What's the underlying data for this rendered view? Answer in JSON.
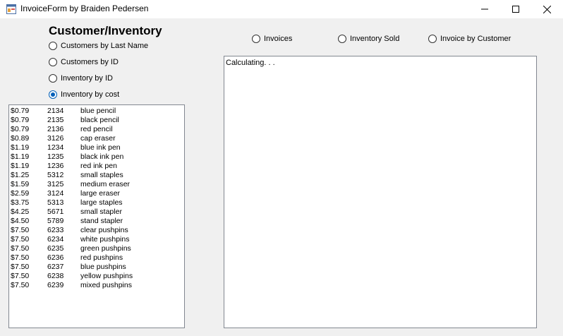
{
  "window": {
    "title": "InvoiceForm by Braiden Pedersen"
  },
  "left_panel": {
    "heading": "Customer/Inventory",
    "options": [
      {
        "label": "Customers by Last Name",
        "checked": false
      },
      {
        "label": "Customers by ID",
        "checked": false
      },
      {
        "label": "Inventory by ID",
        "checked": false
      },
      {
        "label": "Inventory by cost",
        "checked": true
      }
    ]
  },
  "top_options": [
    {
      "label": "Invoices",
      "checked": false
    },
    {
      "label": "Inventory Sold",
      "checked": false
    },
    {
      "label": "Invoice by Customer",
      "checked": false
    }
  ],
  "inventory_list": [
    [
      "$0.79",
      "2134",
      "blue pencil"
    ],
    [
      "$0.79",
      "2135",
      "black pencil"
    ],
    [
      "$0.79",
      "2136",
      "red pencil"
    ],
    [
      "$0.89",
      "3126",
      "cap eraser"
    ],
    [
      "$1.19",
      "1234",
      "blue ink pen"
    ],
    [
      "$1.19",
      "1235",
      "black ink pen"
    ],
    [
      "$1.19",
      "1236",
      "red ink pen"
    ],
    [
      "$1.25",
      "5312",
      "small staples"
    ],
    [
      "$1.59",
      "3125",
      "medium eraser"
    ],
    [
      "$2.59",
      "3124",
      "large eraser"
    ],
    [
      "$3.75",
      "5313",
      "large staples"
    ],
    [
      "$4.25",
      "5671",
      "small stapler"
    ],
    [
      "$4.50",
      "5789",
      "stand stapler"
    ],
    [
      "$7.50",
      "6233",
      "clear pushpins"
    ],
    [
      "$7.50",
      "6234",
      "white pushpins"
    ],
    [
      "$7.50",
      "6235",
      "green pushpins"
    ],
    [
      "$7.50",
      "6236",
      "red pushpins"
    ],
    [
      "$7.50",
      "6237",
      "blue pushpins"
    ],
    [
      "$7.50",
      "6238",
      "yellow pushpins"
    ],
    [
      "$7.50",
      "6239",
      "mixed pushpins"
    ]
  ],
  "output_box": {
    "text": "Calculating. . ."
  },
  "colors": {
    "radio_checked": "#005fb8",
    "background": "#f0f0f0"
  }
}
